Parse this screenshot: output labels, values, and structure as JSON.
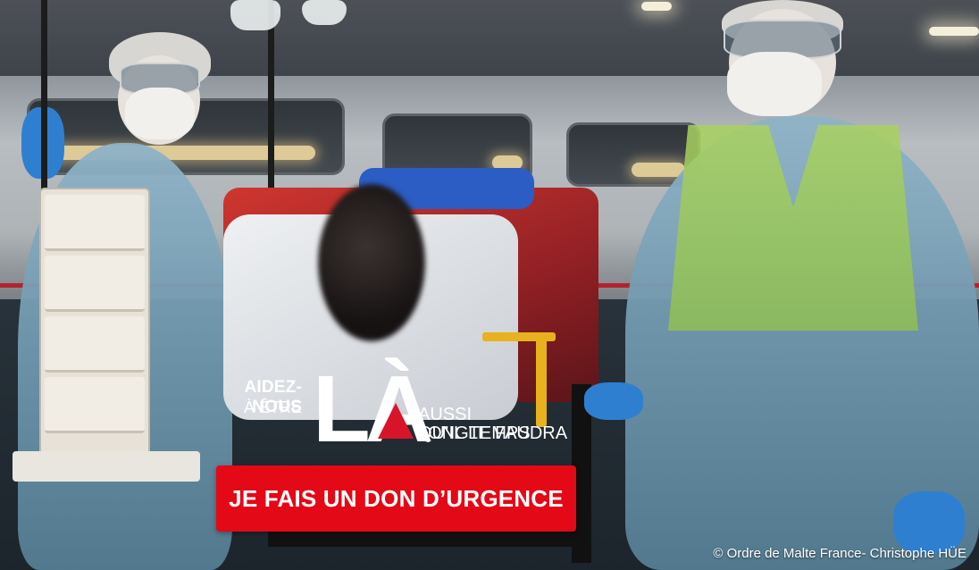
{
  "overlay": {
    "line1": "AIDEZ-NOUS",
    "line2": "À ÊTRE",
    "big_word": "LÀ",
    "line3": "AUSSI LONGTEMPS",
    "line4": "QU’IL LE FAUDRA"
  },
  "cta": {
    "label": "JE FAIS UN DON D’URGENCE"
  },
  "credit": {
    "text": "© Ordre de Malte France- Christophe HÜE"
  },
  "colors": {
    "accent": "#e30917",
    "accent_mark": "#d8142a",
    "text": "#ffffff"
  }
}
